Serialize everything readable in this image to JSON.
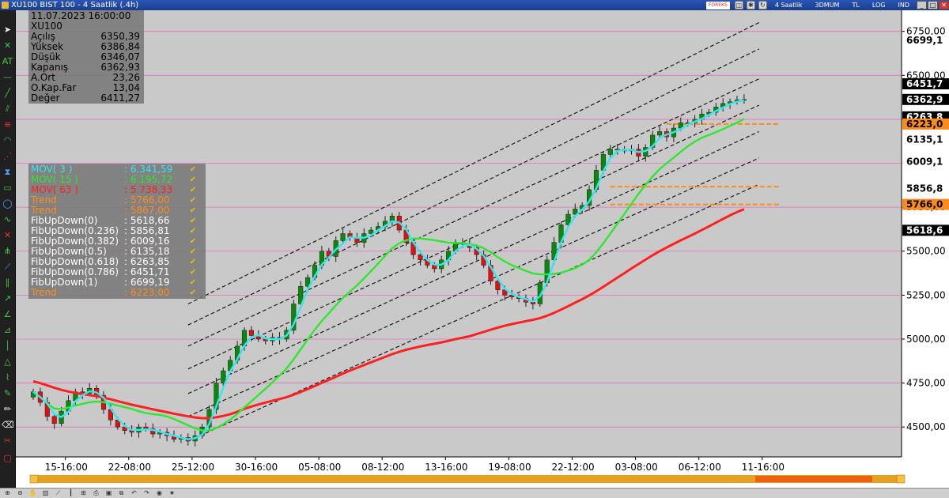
{
  "window": {
    "title": "XU100 BIST 100 - 4 Saatlik  (.4h)",
    "forex_label": "FOREKS",
    "period_label": "4 Saatlik",
    "buttons": [
      "3DMUM",
      "TL",
      "LOG",
      "IND"
    ]
  },
  "info": {
    "datetime": "11.07.2023 16:00:00",
    "symbol": "XU100",
    "rows": [
      {
        "k": "Açılış",
        "v": "6350,39"
      },
      {
        "k": "Yüksek",
        "v": "6386,84"
      },
      {
        "k": "Düşük",
        "v": "6346,07"
      },
      {
        "k": "Kapanış",
        "v": "6362,93"
      },
      {
        "k": "A.Ort",
        "v": "23,26"
      },
      {
        "k": "O.Kap.Far",
        "v": "13,04"
      },
      {
        "k": "Değer",
        "v": "6411,27"
      }
    ]
  },
  "legend": [
    {
      "name": "MOV( 3 )",
      "value": ": 6.341,59",
      "color": "#33e6f0"
    },
    {
      "name": "MOV( 15 )",
      "value": ": 6.195,72",
      "color": "#2ee82e"
    },
    {
      "name": "MOV( 63 )",
      "value": ": 5.738,33",
      "color": "#ff2020"
    },
    {
      "name": "Trend",
      "value": ": 5766,00",
      "color": "#ff8c1a"
    },
    {
      "name": "Trend",
      "value": ": 5867,00",
      "color": "#ff8c1a"
    },
    {
      "name": "FibUpDown(0)",
      "value": ": 5618,66",
      "color": "#ffffff"
    },
    {
      "name": "FibUpDown(0.236)",
      "value": ": 5856,81",
      "color": "#ffffff"
    },
    {
      "name": "FibUpDown(0.382)",
      "value": ": 6009,16",
      "color": "#ffffff"
    },
    {
      "name": "FibUpDown(0.5)",
      "value": ": 6135,18",
      "color": "#ffffff"
    },
    {
      "name": "FibUpDown(0.618)",
      "value": ": 6263,85",
      "color": "#ffffff"
    },
    {
      "name": "FibUpDown(0.786)",
      "value": ": 6451,71",
      "color": "#ffffff"
    },
    {
      "name": "FibUpDown(1)",
      "value": ": 6699,19",
      "color": "#ffffff"
    },
    {
      "name": "Trend",
      "value": ": 6223,00",
      "color": "#ff8c1a"
    }
  ],
  "chart_data": {
    "type": "line",
    "y_axis": {
      "ticks": [
        "4500,00",
        "4750,00",
        "5000,00",
        "5250,00",
        "5500,00",
        "5750,00",
        "6000,00",
        "6250,00",
        "6500,00",
        "6750,00"
      ],
      "tick_values": [
        4500,
        4750,
        5000,
        5250,
        5500,
        5750,
        6000,
        6250,
        6500,
        6750
      ],
      "ylim": [
        4330,
        6870
      ]
    },
    "x_axis": {
      "ticks": [
        "15-16:00",
        "22-08:00",
        "25-12:00",
        "30-16:00",
        "05-08:00",
        "08-12:00",
        "13-16:00",
        "19-08:00",
        "22-12:00",
        "03-08:00",
        "06-12:00",
        "11-16:00"
      ],
      "tick_index": [
        5,
        14,
        23,
        32,
        41,
        50,
        59,
        68,
        77,
        86,
        95,
        104
      ],
      "n_bars": 102
    },
    "value_labels": [
      {
        "text": "6699,1",
        "value": 6699.19,
        "bg": "#ffffff",
        "fg": "#000000"
      },
      {
        "text": "6451,7",
        "value": 6451.71,
        "bg": "#000000",
        "fg": "#ffffff"
      },
      {
        "text": "6362,9",
        "value": 6362.93,
        "bg": "#000000",
        "fg": "#ffffff"
      },
      {
        "text": "6263,8",
        "value": 6263.85,
        "bg": "#000000",
        "fg": "#ffffff"
      },
      {
        "text": "6223,0",
        "value": 6223.0,
        "bg": "#ff8c1a",
        "fg": "#000000"
      },
      {
        "text": "6135,1",
        "value": 6135.18,
        "bg": "#ffffff",
        "fg": "#000000"
      },
      {
        "text": "6009,1",
        "value": 6009.16,
        "bg": "#ffffff",
        "fg": "#000000"
      },
      {
        "text": "5856,8",
        "value": 5856.81,
        "bg": "#ffffff",
        "fg": "#000000"
      },
      {
        "text": "5766,0",
        "value": 5766.0,
        "bg": "#ff8c1a",
        "fg": "#000000"
      },
      {
        "text": "5618,6",
        "value": 5618.66,
        "bg": "#000000",
        "fg": "#ffffff"
      }
    ],
    "closes": [
      4700,
      4640,
      4560,
      4520,
      4590,
      4650,
      4700,
      4690,
      4720,
      4680,
      4600,
      4540,
      4500,
      4480,
      4470,
      4500,
      4490,
      4460,
      4470,
      4450,
      4430,
      4440,
      4420,
      4450,
      4500,
      4600,
      4750,
      4820,
      4880,
      4960,
      5050,
      5020,
      5000,
      4990,
      5010,
      5000,
      5050,
      5200,
      5300,
      5350,
      5420,
      5500,
      5470,
      5560,
      5600,
      5580,
      5550,
      5600,
      5620,
      5640,
      5670,
      5700,
      5620,
      5550,
      5480,
      5450,
      5420,
      5400,
      5450,
      5500,
      5550,
      5540,
      5520,
      5480,
      5420,
      5330,
      5280,
      5250,
      5240,
      5230,
      5210,
      5200,
      5320,
      5450,
      5550,
      5650,
      5710,
      5740,
      5760,
      5850,
      5960,
      6050,
      6080,
      6080,
      6070,
      6080,
      6040,
      6090,
      6160,
      6180,
      6150,
      6200,
      6230,
      6230,
      6250,
      6280,
      6290,
      6320,
      6340,
      6350,
      6360,
      6363
    ],
    "series": [
      {
        "name": "MOV( 3 )",
        "color": "#33e6f0"
      },
      {
        "name": "MOV( 15 )",
        "color": "#2ee82e"
      },
      {
        "name": "MOV( 63 )",
        "color": "#ff2020"
      }
    ],
    "trend_levels": [
      {
        "value": 5867,
        "from_index": 82,
        "to_index": 101,
        "color": "#ff8c1a"
      },
      {
        "value": 5766,
        "from_index": 82,
        "to_index": 101,
        "color": "#ff8c1a"
      },
      {
        "value": 6223,
        "from_index": 90,
        "to_index": 101,
        "color": "#ff8c1a"
      }
    ],
    "horizontal_gridlines": [
      4500,
      4750,
      5000,
      5250,
      5500,
      5750,
      6000,
      6250,
      6500,
      6750
    ],
    "channel_lines": {
      "start_index": 22,
      "end_index": 102,
      "start_values": [
        5200,
        5080,
        4960,
        4830,
        4690,
        4560,
        4420
      ],
      "end_values": [
        6800,
        6650,
        6480,
        6330,
        6180,
        6030,
        5880
      ]
    },
    "legend_placement": "top-left",
    "grid": true
  }
}
